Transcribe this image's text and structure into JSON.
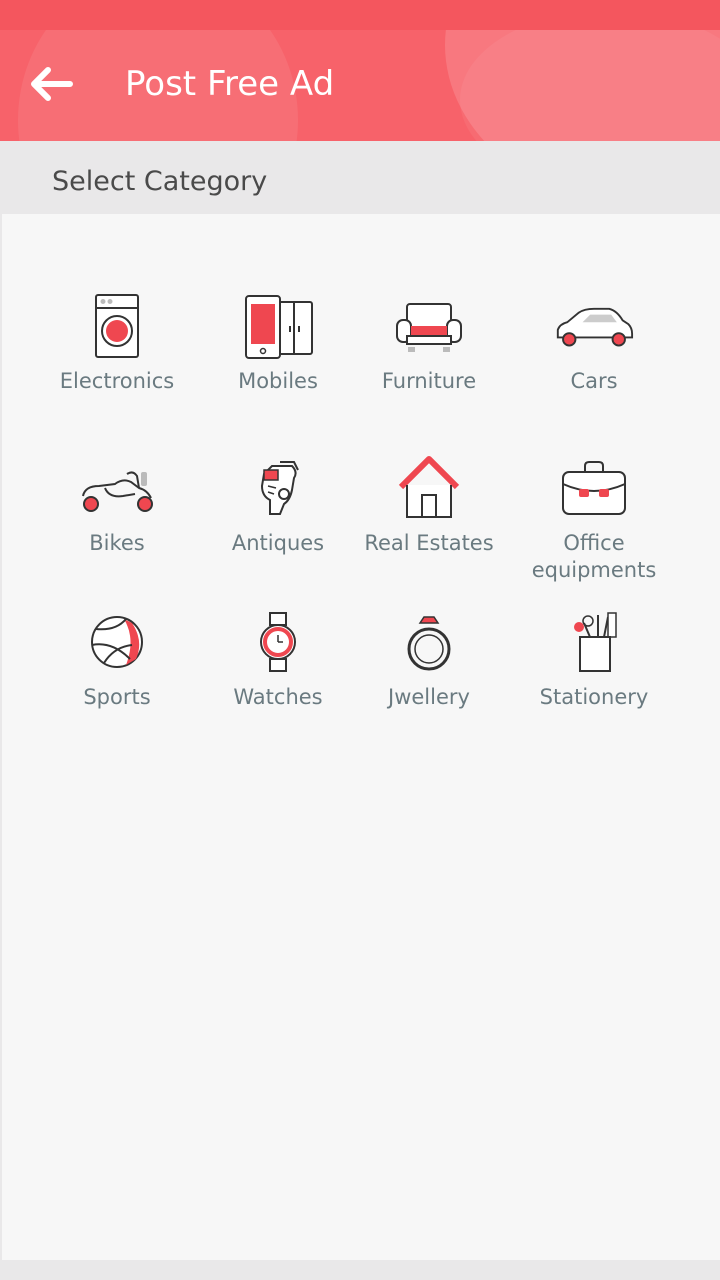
{
  "app_bar": {
    "title": "Post Free Ad",
    "back_icon": "arrow-left-icon"
  },
  "section": {
    "title": "Select Category"
  },
  "categories": [
    {
      "id": "electronics",
      "label": "Electronics",
      "icon": "washing-machine-icon"
    },
    {
      "id": "mobiles",
      "label": "Mobiles",
      "icon": "mobile-phone-icon"
    },
    {
      "id": "furniture",
      "label": "Furniture",
      "icon": "sofa-icon"
    },
    {
      "id": "cars",
      "label": "Cars",
      "icon": "car-icon"
    },
    {
      "id": "bikes",
      "label": "Bikes",
      "icon": "motorbike-icon"
    },
    {
      "id": "antiques",
      "label": "Antiques",
      "icon": "antique-statue-icon"
    },
    {
      "id": "real-estates",
      "label": "Real Estates",
      "icon": "house-icon"
    },
    {
      "id": "office-equipments",
      "label": "Office equipments",
      "icon": "briefcase-icon"
    },
    {
      "id": "sports",
      "label": "Sports",
      "icon": "volleyball-icon"
    },
    {
      "id": "watches",
      "label": "Watches",
      "icon": "wristwatch-icon"
    },
    {
      "id": "jewellery",
      "label": "Jwellery",
      "icon": "ring-icon"
    },
    {
      "id": "stationery",
      "label": "Stationery",
      "icon": "pencil-cup-icon"
    }
  ],
  "colors": {
    "accent": "#f7626a",
    "status_bar": "#f4565e",
    "icon_red": "#ef4750",
    "label": "#6a7a80"
  }
}
